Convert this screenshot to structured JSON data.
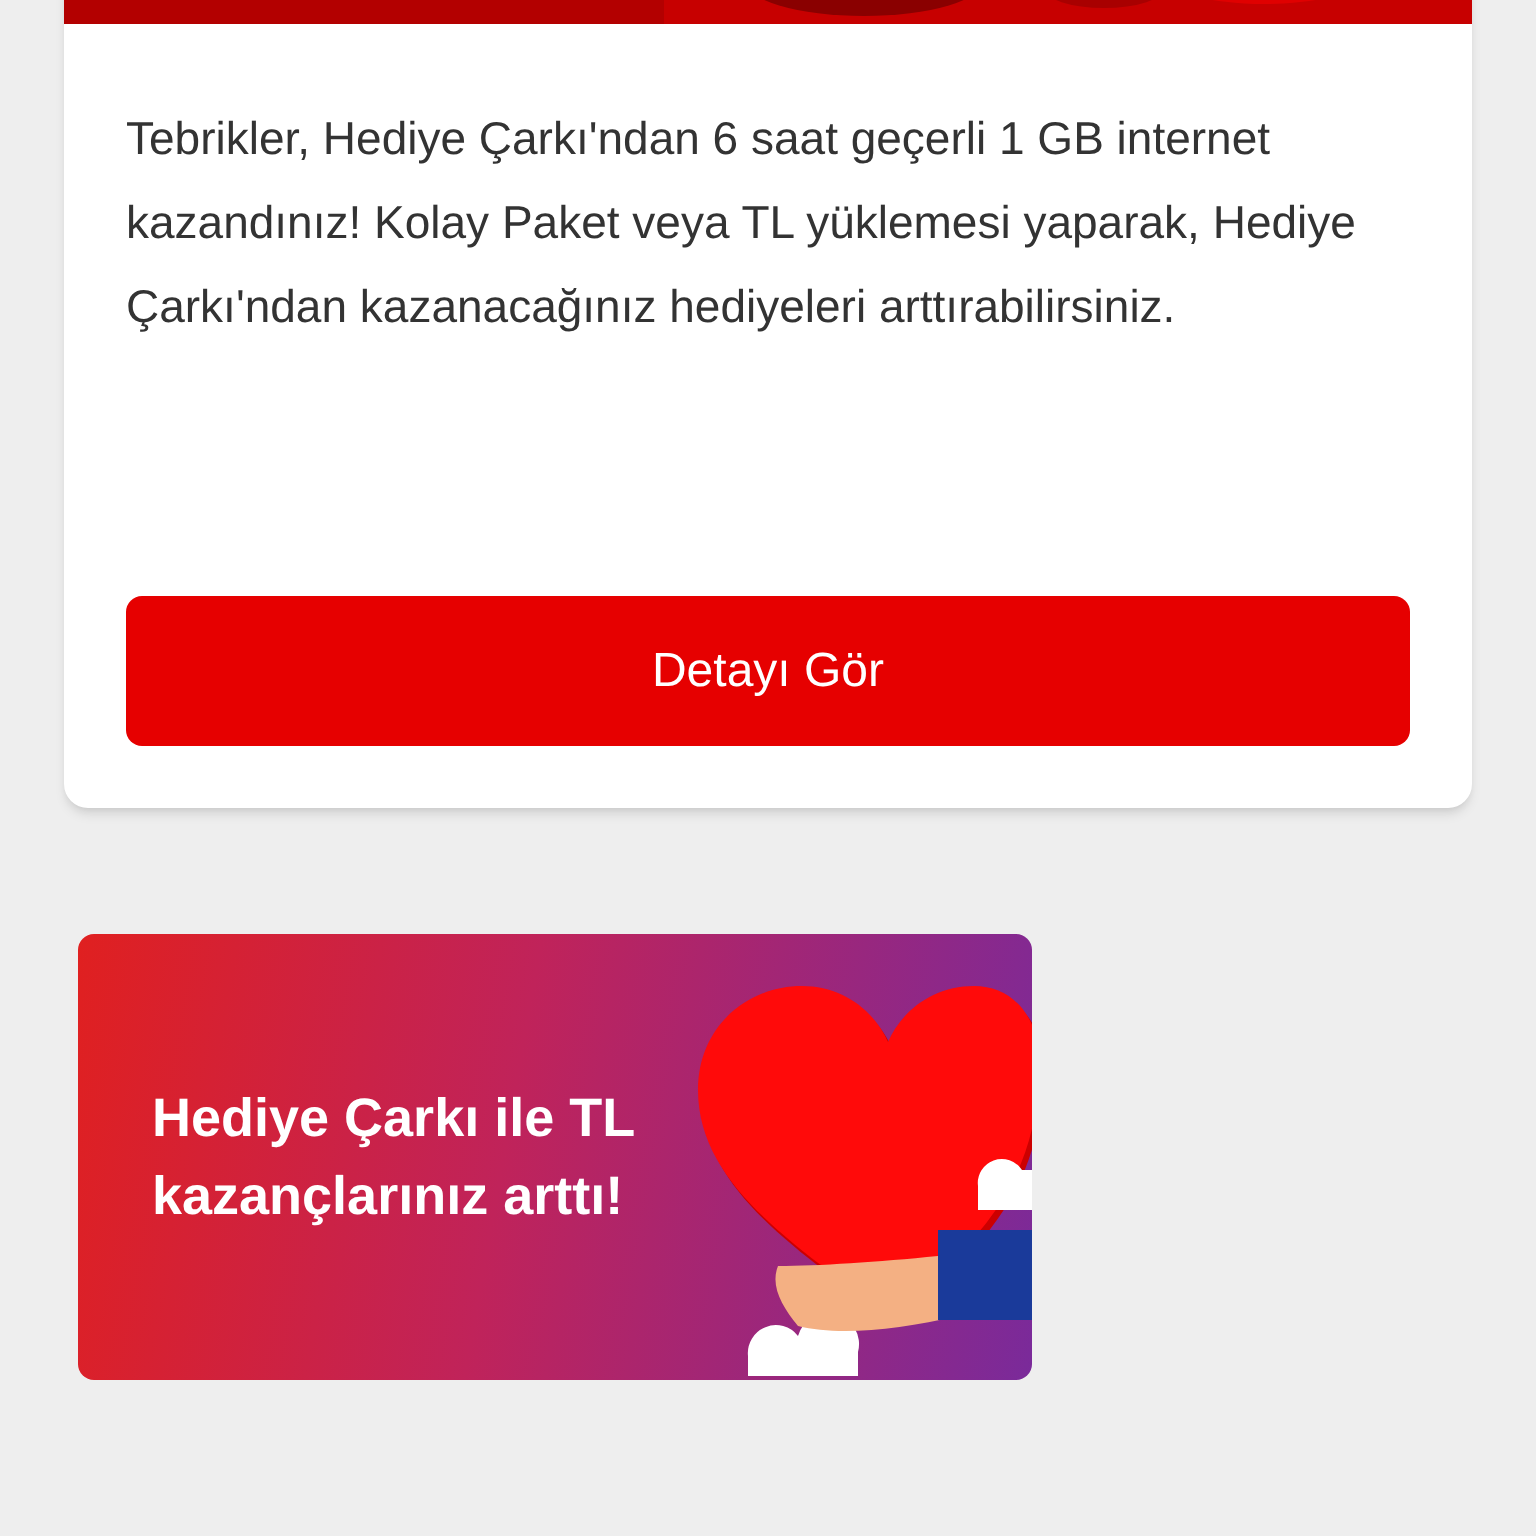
{
  "card": {
    "kind": "picture",
    "message": "Tebrikler, Hediye Çarkı'ndan 6 saat geçerli 1 GB internet kazandınız! Kolay Paket veya TL yüklemesi yaparak, Hediye Çarkı'ndan kazanacağınız hediyeleri arttırabilirsiniz.",
    "button": "Detayı Gör"
  },
  "banner": {
    "title": "Hediye Çarkı ile TL kazançlarınız arttı!"
  }
}
